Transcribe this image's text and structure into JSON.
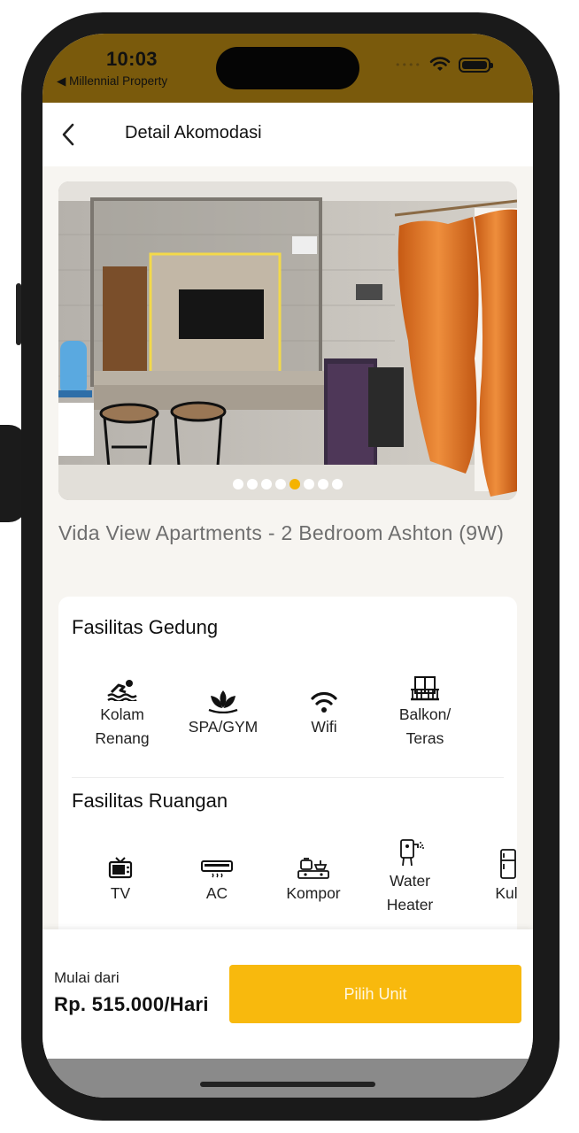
{
  "status_bar": {
    "time": "10:03",
    "back_app": "◀ Millennial Property"
  },
  "header": {
    "title": "Detail Akomodasi"
  },
  "gallery": {
    "page_count": 8,
    "active_index": 5
  },
  "property": {
    "title": "Vida View Apartments - 2 Bedroom Ashton (9W)"
  },
  "building_facilities": {
    "title": "Fasilitas Gedung",
    "items": [
      {
        "label_line1": "Kolam",
        "label_line2": "Renang",
        "icon": "swimming-icon"
      },
      {
        "label_line1": "SPA/GYM",
        "label_line2": "",
        "icon": "lotus-icon"
      },
      {
        "label_line1": "Wifi",
        "label_line2": "",
        "icon": "wifi-icon"
      },
      {
        "label_line1": "Balkon/",
        "label_line2": "Teras",
        "icon": "balcony-icon"
      }
    ]
  },
  "room_facilities": {
    "title": "Fasilitas Ruangan",
    "items": [
      {
        "label_line1": "TV",
        "label_line2": "",
        "icon": "tv-icon"
      },
      {
        "label_line1": "AC",
        "label_line2": "",
        "icon": "ac-icon"
      },
      {
        "label_line1": "Kompor",
        "label_line2": "",
        "icon": "stove-icon"
      },
      {
        "label_line1": "Water",
        "label_line2": "Heater",
        "icon": "water-heater-icon"
      },
      {
        "label_line1": "Kul",
        "label_line2": "",
        "icon": "fridge-icon"
      }
    ]
  },
  "booking": {
    "from_label": "Mulai dari",
    "price": "Rp. 515.000/Hari",
    "cta_label": "Pilih Unit"
  },
  "colors": {
    "accent": "#f8b90d",
    "status_bar": "#7a5a0c",
    "pager_active": "#f5b300"
  }
}
